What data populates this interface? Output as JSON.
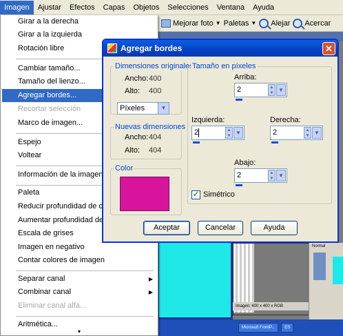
{
  "menubar": {
    "items": [
      "Imagen",
      "Ajustar",
      "Efectos",
      "Capas",
      "Objetos",
      "Selecciones",
      "Ventana",
      "Ayuda"
    ]
  },
  "toolbar": {
    "photo_label": "Mejorar foto",
    "paint_label": "Paletas",
    "zoom_out_label": "Alejar",
    "zoom_in_label": "Acercar"
  },
  "menu": {
    "items": [
      {
        "label": "Girar a la derecha"
      },
      {
        "label": "Girar a la izquierda"
      },
      {
        "label": "Rotación libre"
      },
      {
        "label": "Cambiar tamaño..."
      },
      {
        "label": "Tamaño del lienzo..."
      },
      {
        "label": "Agregar bordes...",
        "highlight": true
      },
      {
        "label": "Recortar selección",
        "disabled": true
      },
      {
        "label": "Marco de imagen..."
      },
      {
        "label": "Espejo"
      },
      {
        "label": "Voltear"
      },
      {
        "label": "Información de la imagen..."
      },
      {
        "label": "Paleta",
        "submenu": true
      },
      {
        "label": "Reducir profundidad de color",
        "submenu": true
      },
      {
        "label": "Aumentar profundidad de color",
        "submenu": true
      },
      {
        "label": "Escala de grises"
      },
      {
        "label": "Imagen en negativo"
      },
      {
        "label": "Contar colores de imagen"
      },
      {
        "label": "Separar canal",
        "submenu": true
      },
      {
        "label": "Combinar canal",
        "submenu": true
      },
      {
        "label": "Eliminar canal alfa...",
        "disabled": true
      },
      {
        "label": "Aritmética..."
      }
    ],
    "more_arrow": "▾"
  },
  "dialog": {
    "title": "Agregar bordes",
    "close_glyph": "✕",
    "original": {
      "title": "Dimensiones originales",
      "width_label": "Ancho:",
      "width_value": "400",
      "height_label": "Alto:",
      "height_value": "400"
    },
    "units": {
      "selected": "Píxeles"
    },
    "new_dims": {
      "title": "Nuevas dimensiones",
      "width_label": "Ancho:",
      "width_value": "404",
      "height_label": "Alto:",
      "height_value": "404"
    },
    "color": {
      "title": "Color",
      "value": "#d7149b"
    },
    "size": {
      "title": "Tamaño en píxeles",
      "top_label": "Arriba:",
      "top_value": "2",
      "left_label": "Izquierda:",
      "left_value": "2",
      "right_label": "Derecha:",
      "right_value": "2",
      "bottom_label": "Abajo:",
      "bottom_value": "2"
    },
    "symmetric": {
      "label": "Simétrico",
      "checked": true
    },
    "buttons": {
      "ok": "Aceptar",
      "cancel": "Cancelar",
      "help": "Ayuda"
    }
  },
  "background": {
    "status_text": "Imagen: 400 x 400 x RGB",
    "task_label": "Microsoft FrontP...",
    "task_tail": "ES",
    "panel_label": "Normal"
  }
}
